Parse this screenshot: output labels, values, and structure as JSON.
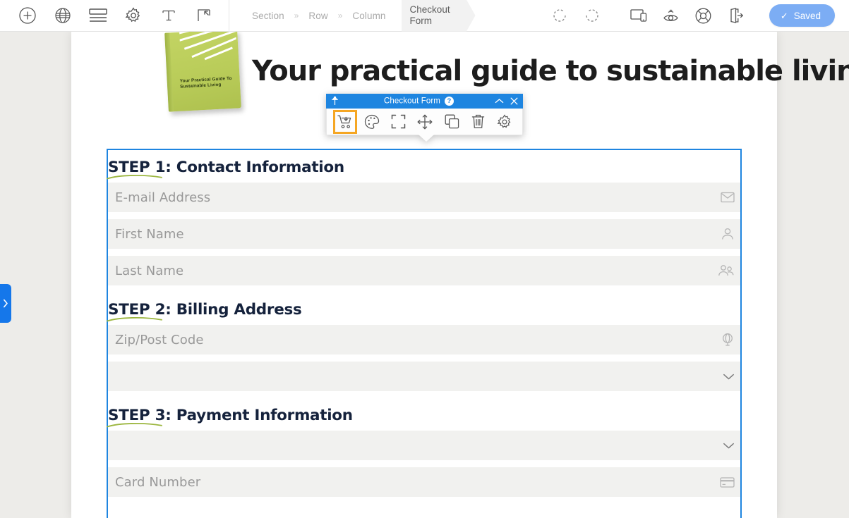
{
  "topbar": {
    "left_tools": [
      {
        "name": "add-module-button",
        "icon": "plus-circle-icon",
        "label": "Add"
      },
      {
        "name": "global-settings-button",
        "icon": "globe-icon",
        "label": "Global"
      },
      {
        "name": "layout-button",
        "icon": "rows-icon",
        "label": "Layout"
      },
      {
        "name": "tools-settings-button",
        "icon": "gear-icon",
        "label": "Tools"
      },
      {
        "name": "typography-button",
        "icon": "text-T-icon",
        "label": "Typography"
      },
      {
        "name": "snippets-button",
        "icon": "frame-arrow-icon",
        "label": "Snippets"
      }
    ],
    "breadcrumb": [
      {
        "label": "Section"
      },
      {
        "label": "Row"
      },
      {
        "label": "Column"
      }
    ],
    "breadcrumb_separator": "»",
    "breadcrumb_active": "Checkout Form",
    "right_tools": [
      {
        "name": "undo-button",
        "icon": "undo-icon",
        "label": "Undo"
      },
      {
        "name": "redo-button",
        "icon": "redo-icon",
        "label": "Redo"
      },
      {
        "name": "responsive-button",
        "icon": "devices-icon",
        "label": "Responsive"
      },
      {
        "name": "preview-button",
        "icon": "eye-icon",
        "label": "Preview"
      },
      {
        "name": "help-button",
        "icon": "lifebuoy-icon",
        "label": "Help"
      },
      {
        "name": "exit-button",
        "icon": "exit-door-icon",
        "label": "Exit"
      }
    ],
    "saved_label": "Saved",
    "saved_check": "✓",
    "saved_color": "#7cadf4"
  },
  "drawer": {
    "chevron": "›"
  },
  "hero": {
    "heading": "Your practical guide to sustainable living",
    "book_title": "Your Practical Guide To Sustainable Living",
    "book_color": "#b9cc59"
  },
  "module_toolbar": {
    "title": "Checkout Form",
    "help_glyph": "?",
    "pin_icon": "pin-icon",
    "collapse_glyph": "⌃",
    "close_glyph": "✕",
    "accent_color": "#1e85e0",
    "active_highlight": "#f5a623",
    "actions": [
      {
        "name": "cart-settings-button",
        "icon": "shopping-cart-icon",
        "active": true
      },
      {
        "name": "style-button",
        "icon": "palette-icon",
        "active": false
      },
      {
        "name": "fullwidth-button",
        "icon": "expand-corners-icon",
        "active": false
      },
      {
        "name": "move-button",
        "icon": "move-arrows-icon",
        "active": false
      },
      {
        "name": "duplicate-button",
        "icon": "duplicate-icon",
        "active": false
      },
      {
        "name": "delete-button",
        "icon": "trash-icon",
        "active": false
      },
      {
        "name": "settings-button",
        "icon": "gear-icon",
        "active": false
      }
    ]
  },
  "form": {
    "selection_color": "#1e85e0",
    "steps": [
      {
        "heading": "STEP 1: Contact Information",
        "fields": [
          {
            "placeholder": "E-mail Address",
            "icon": "envelope-icon",
            "type": "text",
            "name": "email-field"
          },
          {
            "placeholder": "First Name",
            "icon": "user-icon",
            "type": "text",
            "name": "first-name-field"
          },
          {
            "placeholder": "Last Name",
            "icon": "users-icon",
            "type": "text",
            "name": "last-name-field"
          }
        ]
      },
      {
        "heading": "STEP 2: Billing Address",
        "fields": [
          {
            "placeholder": "Zip/Post Code",
            "icon": "globe-location-icon",
            "type": "text",
            "name": "zip-field"
          },
          {
            "placeholder": "",
            "icon": "chevron-down-icon",
            "type": "select",
            "name": "country-select"
          }
        ]
      },
      {
        "heading": "STEP 3: Payment Information",
        "fields": [
          {
            "placeholder": "",
            "icon": "chevron-down-icon",
            "type": "select",
            "name": "card-type-select"
          },
          {
            "placeholder": "Card Number",
            "icon": "credit-card-icon",
            "type": "text",
            "name": "card-number-field"
          }
        ]
      }
    ]
  }
}
